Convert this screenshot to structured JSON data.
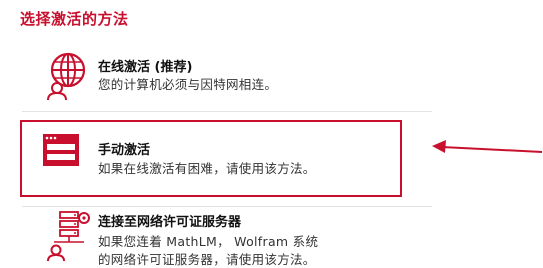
{
  "heading": "选择激活的方法",
  "options": [
    {
      "title": "在线激活 (推荐)",
      "desc": "您的计算机必须与因特网相连。"
    },
    {
      "title": "手动激活",
      "desc": "如果在线激活有困难，请使用该方法。"
    },
    {
      "title": "连接至网络许可证服务器",
      "desc": "如果您连着 MathLM， Wolfram 系统",
      "desc2": "的网络许可证服务器，请使用该方法。"
    }
  ],
  "colors": {
    "accent": "#c8102e"
  },
  "icons": [
    "globe-user-icon",
    "activation-window-icon",
    "network-server-user-icon",
    "annotation-arrow-icon"
  ]
}
